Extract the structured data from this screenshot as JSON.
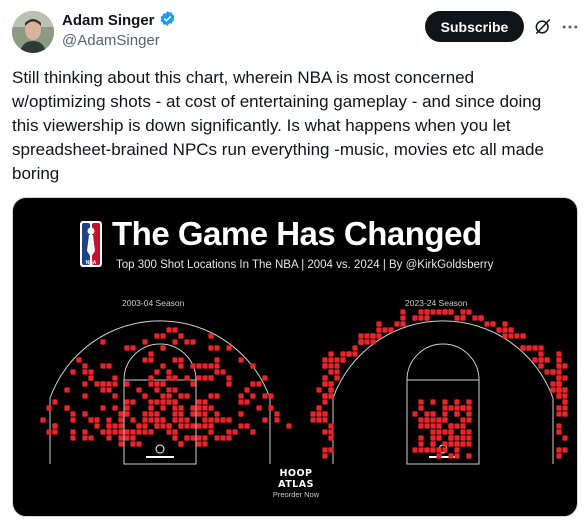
{
  "author": {
    "name": "Adam Singer",
    "handle": "@AdamSinger",
    "verified_color": "#1d9bf0",
    "avatar_icon": "avatar"
  },
  "actions": {
    "subscribe_label": "Subscribe",
    "grok_icon": "grok-icon",
    "more_icon": "more-options-icon"
  },
  "tweet": {
    "text": "Still thinking about this chart, wherein NBA is most concerned w/optimizing shots - at cost of entertaining gameplay - and since doing this viewership is down significantly. Is what happens when you let spreadsheet-brained NPCs run everything -music, movies etc all made boring"
  },
  "media": {
    "logo_text": "NBA",
    "title": "The Game Has Changed",
    "subtitle": "Top 300 Shot Locations In The NBA | 2004 vs. 2024 | By @KirkGoldsberry",
    "left_season": "2003-04 Season",
    "right_season": "2023-24 Season",
    "badge_line1": "HOOP ATLAS",
    "badge_line2": "Preorder Now",
    "dot_color": "#e8252a",
    "line_color": "#cfcfcf"
  }
}
